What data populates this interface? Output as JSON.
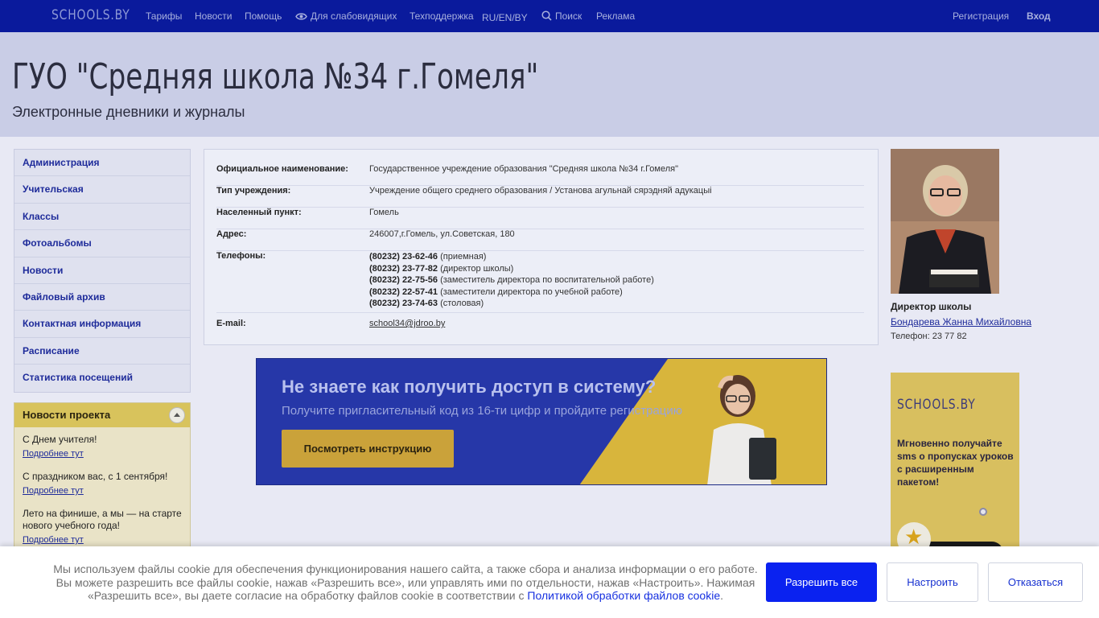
{
  "topbar": {
    "logo": "SCHOOLS.BY",
    "nav": [
      "Тарифы",
      "Новости",
      "Помощь",
      "Для слабовидящих",
      "Техподдержка",
      "RU/EN/BY",
      "Поиск",
      "Реклама"
    ],
    "register": "Регистрация",
    "login": "Вход"
  },
  "header": {
    "title": "ГУО \"Средняя школа №34 г.Гомеля\"",
    "subtitle": "Электронные дневники и журналы"
  },
  "sidebar": {
    "items": [
      "Администрация",
      "Учительская",
      "Классы",
      "Фотоальбомы",
      "Новости",
      "Файловый архив",
      "Контактная информация",
      "Расписание",
      "Статистика посещений"
    ]
  },
  "news": {
    "title": "Новости проекта",
    "items": [
      {
        "text": "С Днем учителя!",
        "more": "Подробнее тут"
      },
      {
        "text": "С праздником вас, с 1 сентября!",
        "more": "Подробнее тут"
      },
      {
        "text": "Лето на финише, а мы — на старте нового учебного года!",
        "more": "Подробнее тут"
      }
    ]
  },
  "info": {
    "official_name": {
      "label": "Официальное наименование:",
      "value": "Государственное учреждение образования \"Средняя школа №34 г.Гомеля\""
    },
    "type": {
      "label": "Тип учреждения:",
      "value": "Учреждение общего среднего образования / Установа агульнай сярэдняй адукацыi"
    },
    "city": {
      "label": "Населенный пункт:",
      "value": "Гомель"
    },
    "address": {
      "label": "Адрес:",
      "value": "246007,г.Гомель, ул.Советская, 180"
    },
    "phones": {
      "label": "Телефоны:",
      "items": [
        {
          "number": "(80232) 23-62-46",
          "note": "(приемная)"
        },
        {
          "number": "(80232) 23-77-82",
          "note": "(директор школы)"
        },
        {
          "number": "(80232) 22-75-56",
          "note": "(заместитель директора по воспитательной работе)"
        },
        {
          "number": "(80232) 22-57-41",
          "note": "(заместители директора по учебной работе)"
        },
        {
          "number": "(80232) 23-74-63",
          "note": "(столовая)"
        }
      ]
    },
    "email": {
      "label": "E-mail:",
      "value": "school34@jdroo.by"
    }
  },
  "banner": {
    "title": "Не знаете как получить доступ в систему?",
    "subtitle": "Получите пригласительный код из 16-ти цифр и пройдите регистрацию",
    "button": "Посмотреть инструкцию"
  },
  "director": {
    "role": "Директор школы",
    "name": "Бондарева Жанна Михайловна",
    "phone": "Телефон: 23 77 82"
  },
  "side_ad": {
    "brand": "SCHOOLS.BY",
    "text": "Мгновенно получайте sms о пропусках уроков с расширенным пакетом!"
  },
  "cookie": {
    "text_before": "Мы используем файлы cookie для обеспечения функционирования нашего сайта, а также сбора и анализа информации о его работе. Вы можете разрешить все файлы cookie, нажав «Разрешить все», или управлять ими по отдельности, нажав «Настроить». Нажимая «Разрешить все», вы даете согласие на обработку файлов cookie в соответствии с ",
    "policy_link": "Политикой обработки файлов cookie",
    "text_after": ".",
    "allow": "Разрешить все",
    "configure": "Настроить",
    "reject": "Отказаться"
  }
}
